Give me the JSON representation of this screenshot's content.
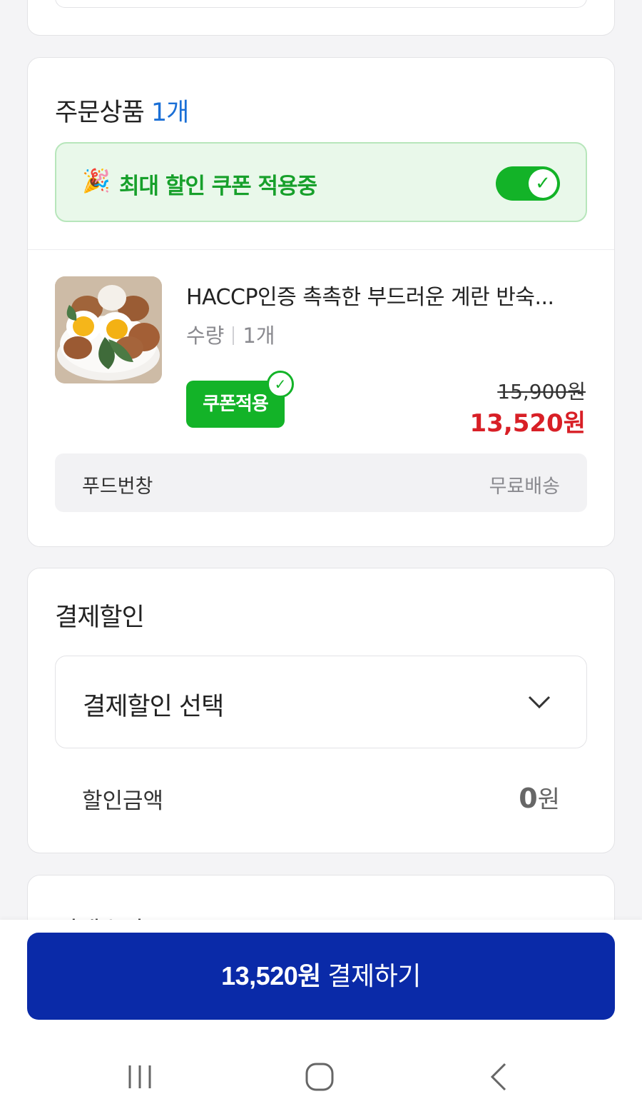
{
  "order": {
    "title": "주문상품",
    "count": "1개",
    "coupon_banner": "최대 할인 쿠폰 적용중",
    "coupon_toggle_on": true,
    "item": {
      "name": "HACCP인증 촉촉한 부드러운 계란 반숙...",
      "qty_label": "수량",
      "qty_value": "1개",
      "coupon_tag": "쿠폰적용",
      "original_price": "15,900원",
      "sale_price": "13,520원"
    },
    "seller": "푸드번창",
    "shipping": "무료배송"
  },
  "discount": {
    "title": "결제할인",
    "select_placeholder": "결제할인 선택",
    "amount_label": "할인금액",
    "amount_number": "0",
    "amount_unit": "원"
  },
  "method": {
    "title": "결제수단"
  },
  "pay": {
    "amount": "13,520원",
    "label": "결제하기"
  },
  "colors": {
    "accent_blue": "#0a2aa8",
    "count_blue": "#1a6fd6",
    "coupon_green": "#13b328",
    "sale_red": "#d81f26"
  }
}
